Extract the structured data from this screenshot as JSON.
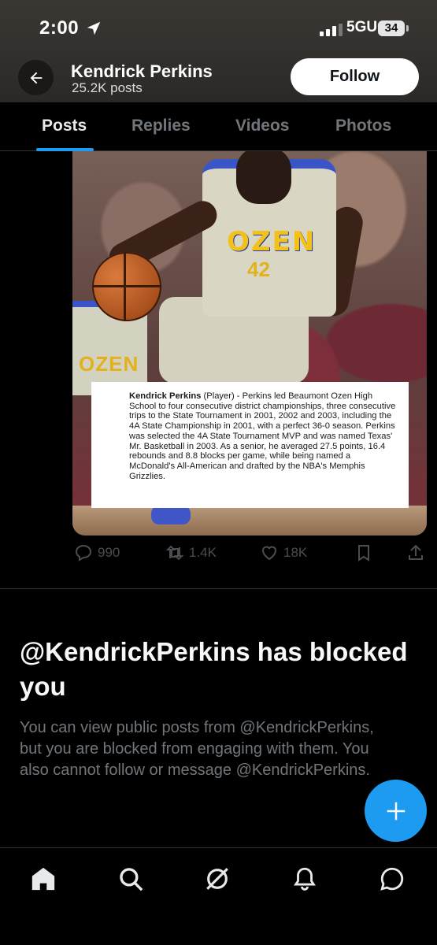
{
  "status_bar": {
    "time": "2:00",
    "network": "5GUC",
    "battery": "34"
  },
  "header": {
    "title": "Kendrick Perkins",
    "subtitle": "25.2K posts",
    "follow_label": "Follow"
  },
  "tabs": [
    {
      "label": "Posts",
      "active": true
    },
    {
      "label": "Replies",
      "active": false
    },
    {
      "label": "Videos",
      "active": false
    },
    {
      "label": "Photos",
      "active": false
    }
  ],
  "post": {
    "jersey_text": "OZEN",
    "jersey_number": "42",
    "teammate_jersey_text": "OZEN",
    "caption_name": "Kendrick Perkins",
    "caption_role": " (Player) - Perkins led Beaumont Ozen High School to four consecutive district championships, three consecutive trips to the State Tournament in 2001, 2002 and 2003, including the 4A State Championship in 2001, with a perfect 36-0 season. Perkins was selected the 4A State Tournament MVP and was named Texas' Mr. Basketball in 2003. As a senior, he averaged 27.5 points, 16.4 rebounds and 8.8 blocks per game, while being named a McDonald's All-American and drafted by the NBA's Memphis Grizzlies.",
    "actions": {
      "replies": "990",
      "reposts": "1.4K",
      "likes": "18K"
    }
  },
  "blocked": {
    "title": "@KendrickPerkins has blocked you",
    "body": "You can view public posts from @KendrickPerkins, but you are blocked from engaging with them. You also cannot follow or message @KendrickPerkins."
  },
  "nav": [
    "home-icon",
    "search-icon",
    "grok-icon",
    "notifications-icon",
    "messages-icon"
  ],
  "colors": {
    "accent": "#1d9bf0",
    "background": "#000000",
    "muted": "#71767b"
  }
}
